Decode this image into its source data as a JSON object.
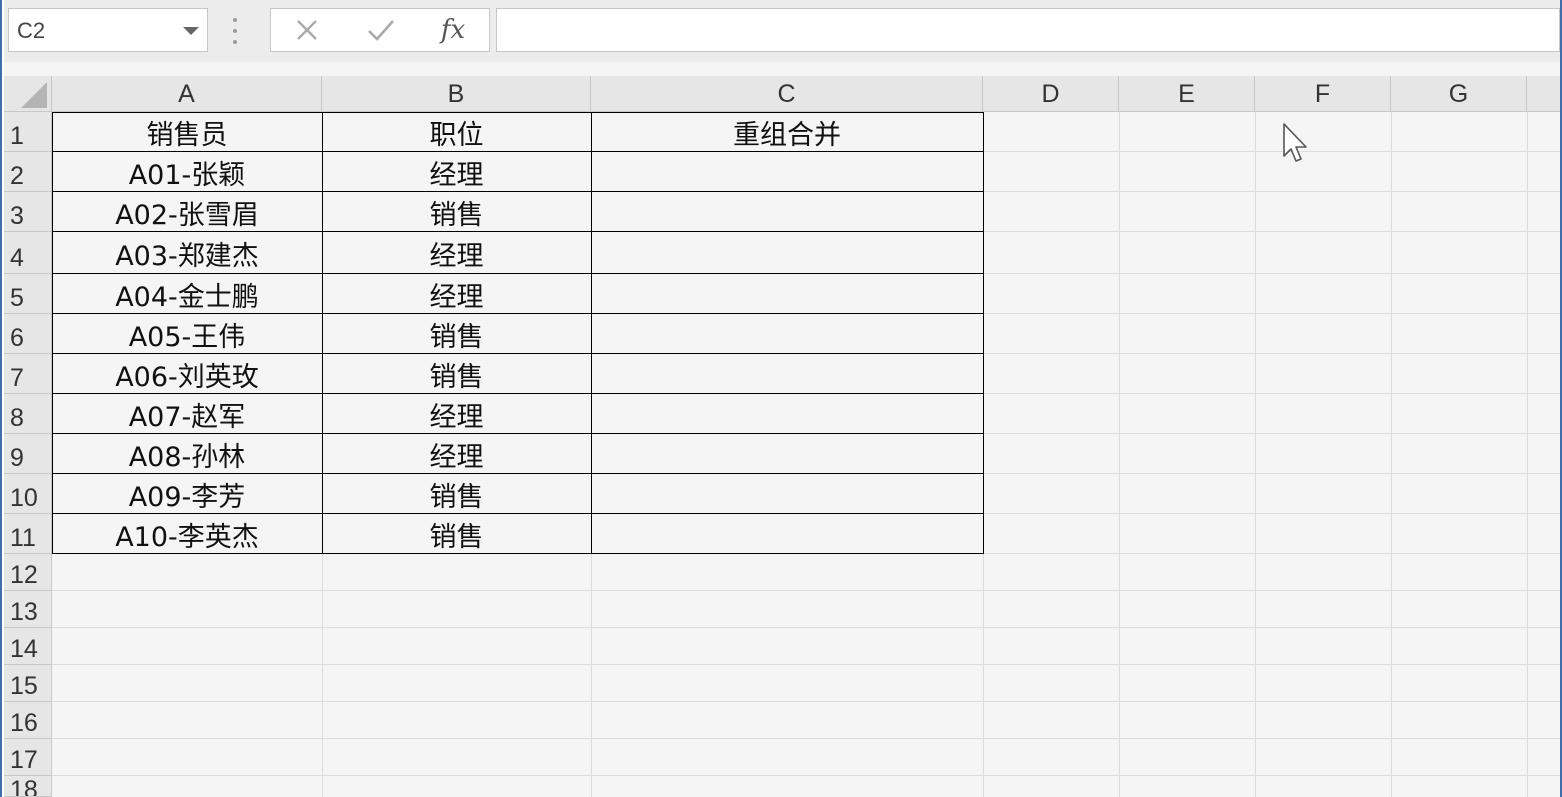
{
  "name_box": {
    "value": "C2"
  },
  "formula_bar": {
    "cancel_icon": "close-icon",
    "enter_icon": "check-icon",
    "fx_label": "fx",
    "formula": ""
  },
  "sheet": {
    "columns": [
      "A",
      "B",
      "C",
      "D",
      "E",
      "F",
      "G"
    ],
    "rows": [
      "1",
      "2",
      "3",
      "4",
      "5",
      "6",
      "7",
      "8",
      "9",
      "10",
      "11",
      "12",
      "13",
      "14",
      "15",
      "16",
      "17",
      "18"
    ],
    "headers": [
      "销售员",
      "职位",
      "重组合并"
    ],
    "data": [
      [
        "A01-张颖",
        "经理",
        ""
      ],
      [
        "A02-张雪眉",
        "销售",
        ""
      ],
      [
        "A03-郑建杰",
        "经理",
        ""
      ],
      [
        "A04-金士鹏",
        "经理",
        ""
      ],
      [
        "A05-王伟",
        "销售",
        ""
      ],
      [
        "A06-刘英玫",
        "销售",
        ""
      ],
      [
        "A07-赵军",
        "经理",
        ""
      ],
      [
        "A08-孙林",
        "经理",
        ""
      ],
      [
        "A09-李芳",
        "销售",
        ""
      ],
      [
        "A10-李英杰",
        "销售",
        ""
      ]
    ]
  },
  "colors": {
    "window_border": "#3f6fa8",
    "header_bg": "#e6e6e6",
    "sheet_bg": "#f5f5f5",
    "table_border": "#000000"
  }
}
